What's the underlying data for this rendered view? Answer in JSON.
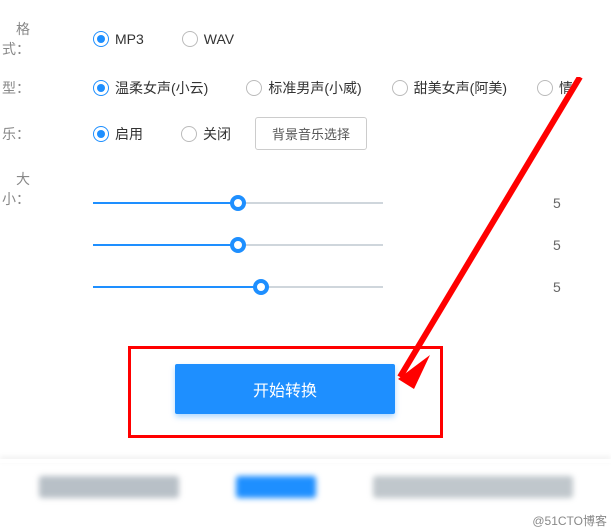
{
  "labels": {
    "format": "格式：",
    "voice_type": "型：",
    "bgm": "乐：",
    "size": "大小："
  },
  "format": {
    "mp3": "MP3",
    "wav": "WAV",
    "selected": "mp3"
  },
  "voice": {
    "opt1": "温柔女声(小云)",
    "opt2": "标准男声(小威)",
    "opt3": "甜美女声(阿美)",
    "opt4": "情",
    "selected": "opt1"
  },
  "bgm": {
    "enable": "启用",
    "disable": "关闭",
    "button": "背景音乐选择",
    "selected": "enable"
  },
  "sliders": {
    "s1": {
      "value": 5,
      "percent": 50
    },
    "s2": {
      "value": 5,
      "percent": 50
    },
    "s3": {
      "value": 5,
      "percent": 58
    }
  },
  "primary_button": "开始转换",
  "watermark": "@51CTO博客",
  "colors": {
    "accent": "#1e8fff",
    "highlight": "#ff0000"
  }
}
